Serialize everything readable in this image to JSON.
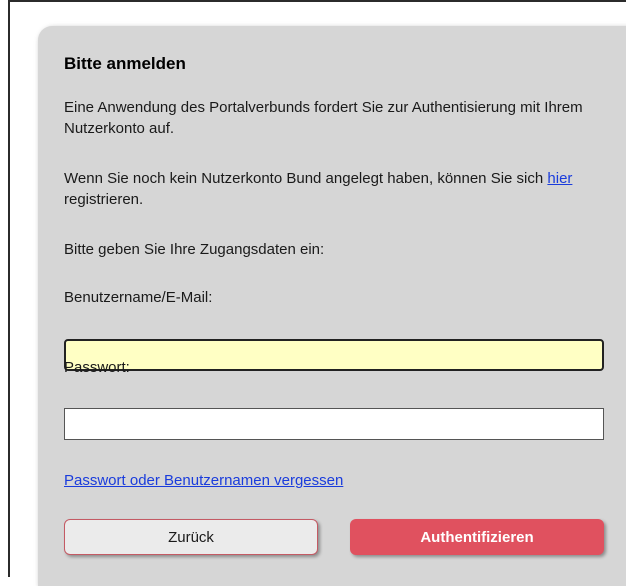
{
  "login": {
    "title": "Bitte anmelden",
    "intro": "Eine Anwendung des Portalverbunds fordert Sie zur Authentisierung mit Ihrem Nutzerkonto auf.",
    "account_prefix": "Wenn Sie noch kein Nutzerkonto Bund angelegt haben, können Sie sich ",
    "account_link": "hier",
    "account_suffix": " registrieren.",
    "prompt": "Bitte geben Sie Ihre Zugangsdaten ein:",
    "username_label": "Benutzername/E-Mail:",
    "username_value": "",
    "password_label": "Passwort:",
    "password_value": "",
    "forgot_link": "Passwort oder Benutzernamen vergessen",
    "back_button": "Zurück",
    "auth_button": "Authentifizieren"
  },
  "colors": {
    "panel_background": "#d6d6d6",
    "active_input_background": "#ffffc4",
    "primary_button": "#e0515f",
    "link": "#1a3cdc"
  }
}
